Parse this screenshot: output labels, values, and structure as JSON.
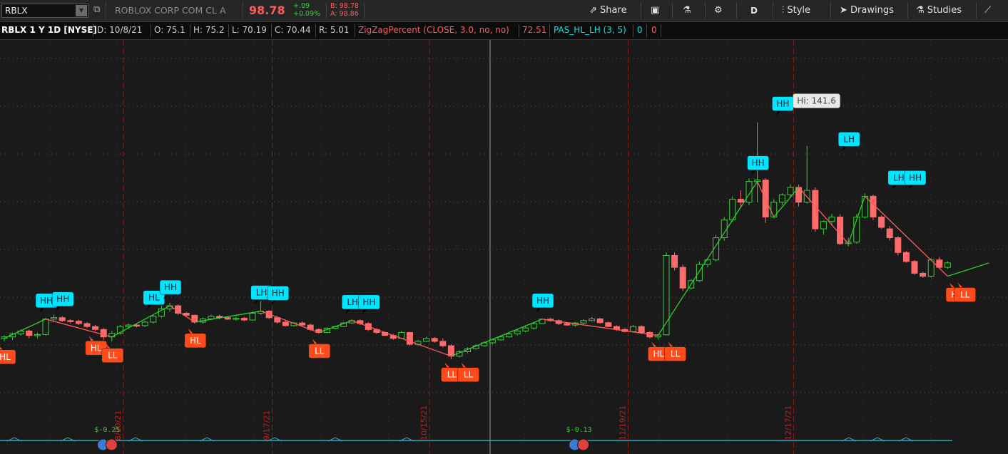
{
  "toolbar": {
    "symbol": "RBLX",
    "company": "ROBLOX CORP COM CL A",
    "price": "98.78",
    "change": "+.09",
    "change_pct": "+0.09%",
    "bid": "B: 98.78",
    "ask": "A: 98.86",
    "share_label": "Share",
    "period_label": "D",
    "style_label": "Style",
    "drawings_label": "Drawings",
    "studies_label": "Studies",
    "colors": {
      "price": "#ff5b5b",
      "up": "#3ccf3c",
      "bid_ask": "#ff5b5b"
    }
  },
  "info": {
    "title": "RBLX 1 Y 1D [NYSE]",
    "date": "D: 10/8/21",
    "open": "O: 75.1",
    "high": "H: 75.2",
    "low": "L: 70.19",
    "close": "C: 70.44",
    "range": "R: 5.01",
    "study1": "ZigZagPercent (CLOSE, 3.0, no, no)",
    "study1_value": "72.51",
    "study2": "PAS_HL_LH (3, 5)",
    "study2_v1": "0",
    "study2_v2": "0"
  },
  "chart_data": {
    "type": "candlestick",
    "ylim": [
      35,
      165
    ],
    "up_color": "#3ccf3c",
    "down_color": "#ff6b6b",
    "candles": [
      [
        69,
        70,
        68,
        69.5
      ],
      [
        69.5,
        71,
        68.5,
        70.5
      ],
      [
        70.5,
        72,
        70,
        71.5
      ],
      [
        71.5,
        72,
        69,
        70
      ],
      [
        70,
        71,
        69,
        70.3
      ],
      [
        70.3,
        76,
        70,
        75.5
      ],
      [
        75.5,
        77,
        74.5,
        76
      ],
      [
        76,
        76.5,
        74.5,
        75
      ],
      [
        75,
        75.5,
        74,
        74.8
      ],
      [
        74.8,
        75.3,
        73.5,
        74
      ],
      [
        74,
        74.5,
        72.5,
        73
      ],
      [
        73,
        73.5,
        71.5,
        72
      ],
      [
        72,
        72.5,
        68.5,
        69.5
      ],
      [
        69.5,
        71.5,
        68,
        70.7
      ],
      [
        70.7,
        73.5,
        70.3,
        73
      ],
      [
        73,
        74,
        72.2,
        73.5
      ],
      [
        73.5,
        74,
        72.7,
        73.3
      ],
      [
        73.3,
        75,
        72.8,
        74.5
      ],
      [
        74.5,
        77,
        74,
        76.5
      ],
      [
        76.5,
        80,
        76,
        79
      ],
      [
        79,
        81,
        78,
        80
      ],
      [
        80,
        80.5,
        77,
        77.5
      ],
      [
        77.5,
        78,
        76.5,
        76.8
      ],
      [
        76.8,
        77,
        74,
        74.5
      ],
      [
        74.5,
        76,
        74,
        75.6
      ],
      [
        75.6,
        77,
        75.2,
        76.5
      ],
      [
        76.5,
        77,
        75.5,
        76
      ],
      [
        76,
        76.5,
        75.2,
        75.5
      ],
      [
        75.5,
        76.3,
        75,
        75.8
      ],
      [
        75.8,
        76.2,
        74.8,
        75.2
      ],
      [
        75.2,
        78,
        75,
        77.5
      ],
      [
        77.5,
        81.5,
        77,
        78.2
      ],
      [
        78.2,
        78.5,
        75.5,
        76
      ],
      [
        76,
        76.5,
        74,
        74.5
      ],
      [
        74.5,
        75,
        73,
        73.3
      ],
      [
        73.3,
        74.5,
        73,
        74.2
      ],
      [
        74.2,
        74.8,
        73.2,
        73.5
      ],
      [
        73.5,
        74,
        71.5,
        72
      ],
      [
        72,
        72.4,
        70.5,
        71
      ],
      [
        71,
        72.8,
        70.8,
        72.4
      ],
      [
        72.4,
        73.3,
        72,
        73
      ],
      [
        73,
        74.5,
        72.8,
        74.2
      ],
      [
        74.2,
        75.5,
        74,
        75
      ],
      [
        75,
        75.4,
        73.5,
        74
      ],
      [
        74,
        74.5,
        71.5,
        72
      ],
      [
        72,
        72.4,
        70.5,
        71
      ],
      [
        71,
        71.3,
        69.8,
        70
      ],
      [
        70,
        70.5,
        68.5,
        69
      ],
      [
        69,
        71.5,
        68.8,
        71
      ],
      [
        71,
        71.2,
        66.5,
        67
      ],
      [
        67,
        68.5,
        66.5,
        68
      ],
      [
        68,
        69.5,
        67.8,
        69
      ],
      [
        69,
        69.4,
        67.5,
        68
      ],
      [
        68,
        69,
        66,
        66.5
      ],
      [
        66.5,
        67,
        62,
        63
      ],
      [
        63,
        65,
        62.5,
        64.5
      ],
      [
        64.5,
        66,
        64,
        65.5
      ],
      [
        65.5,
        67,
        65.2,
        66.5
      ],
      [
        66.5,
        68,
        66.2,
        67.5
      ],
      [
        67.5,
        69,
        67,
        68.5
      ],
      [
        68.5,
        70,
        68.3,
        69.5
      ],
      [
        69.5,
        71,
        69.2,
        70.5
      ],
      [
        70.5,
        72,
        70,
        71.5
      ],
      [
        71.5,
        73,
        71,
        72.5
      ],
      [
        72.5,
        74.5,
        72,
        74
      ],
      [
        74,
        75.7,
        73.8,
        75.5
      ],
      [
        75.5,
        76,
        74.6,
        75
      ],
      [
        75,
        75.4,
        73.5,
        74
      ],
      [
        74,
        74.3,
        73.2,
        73.5
      ],
      [
        73.5,
        74.5,
        73,
        74.2
      ],
      [
        74.2,
        75.5,
        73.8,
        75
      ],
      [
        75,
        76.2,
        74.8,
        75.6
      ],
      [
        75.6,
        76,
        74,
        74.3
      ],
      [
        74.3,
        74.6,
        72.8,
        73
      ],
      [
        73,
        73.4,
        71.5,
        72
      ],
      [
        72,
        72.5,
        71,
        71.3
      ],
      [
        71.3,
        73.5,
        71,
        73
      ],
      [
        73,
        73.4,
        70.5,
        71
      ],
      [
        71,
        71.4,
        69,
        69.5
      ],
      [
        69.5,
        70.4,
        68.5,
        70.2
      ],
      [
        70.2,
        98,
        70,
        97
      ],
      [
        97,
        98,
        92,
        93
      ],
      [
        93,
        94,
        85,
        86
      ],
      [
        86,
        89,
        85.5,
        88.5
      ],
      [
        88.5,
        95,
        88,
        94
      ],
      [
        94,
        96,
        93,
        95.5
      ],
      [
        95.5,
        104,
        95,
        103
      ],
      [
        103,
        110,
        102,
        109
      ],
      [
        109,
        117,
        108.5,
        116
      ],
      [
        116,
        119,
        113,
        115
      ],
      [
        115,
        123,
        114,
        122
      ],
      [
        122,
        142,
        115,
        122.5
      ],
      [
        122.5,
        123,
        108,
        110
      ],
      [
        110,
        116,
        109.5,
        115
      ],
      [
        115,
        118,
        114,
        117.5
      ],
      [
        117.5,
        121,
        116.5,
        120
      ],
      [
        120,
        121,
        113.5,
        115
      ],
      [
        115,
        134,
        114.5,
        119
      ],
      [
        119,
        120,
        105,
        106
      ],
      [
        106,
        109,
        104,
        108.5
      ],
      [
        108.5,
        111,
        107.5,
        110
      ],
      [
        110,
        111,
        100.5,
        101
      ],
      [
        101,
        103,
        100,
        101.5
      ],
      [
        101.5,
        111,
        101,
        110
      ],
      [
        110,
        118,
        109.5,
        117
      ],
      [
        117,
        117.5,
        109,
        110
      ],
      [
        110,
        110.5,
        106,
        106.5
      ],
      [
        106,
        107,
        102,
        103
      ],
      [
        103,
        103.5,
        97,
        98
      ],
      [
        98,
        98.5,
        94.5,
        95
      ],
      [
        95,
        95.5,
        90.5,
        91
      ],
      [
        91,
        91.5,
        89.5,
        90
      ],
      [
        90,
        96,
        89.5,
        95.5
      ],
      [
        95.5,
        96.5,
        92.5,
        93
      ],
      [
        93,
        95,
        92.5,
        94.5
      ]
    ],
    "zigzag": [
      [
        0,
        69
      ],
      [
        5,
        75.5
      ],
      [
        13,
        69.5
      ],
      [
        20,
        80
      ],
      [
        23,
        74.5
      ],
      [
        31,
        78.2
      ],
      [
        38,
        71
      ],
      [
        42,
        75
      ],
      [
        54,
        63
      ],
      [
        65,
        75.5
      ],
      [
        79,
        70
      ],
      [
        91,
        122
      ],
      [
        93,
        110
      ],
      [
        96,
        120
      ],
      [
        102,
        101
      ],
      [
        104,
        117
      ],
      [
        114,
        90
      ],
      [
        119,
        94.5
      ]
    ],
    "labels": [
      {
        "text": "HL",
        "idx": 0,
        "price": 69,
        "pos": "below"
      },
      {
        "text": "HH",
        "idx": 5,
        "price": 75.5,
        "pos": "above"
      },
      {
        "text": "HH",
        "idx": 7,
        "price": 76,
        "pos": "above"
      },
      {
        "text": "HL",
        "idx": 11,
        "price": 72,
        "pos": "below"
      },
      {
        "text": "LL",
        "idx": 13,
        "price": 69.5,
        "pos": "below"
      },
      {
        "text": "HL",
        "idx": 18,
        "price": 76.5,
        "pos": "above"
      },
      {
        "text": "HH",
        "idx": 20,
        "price": 80,
        "pos": "above"
      },
      {
        "text": "HL",
        "idx": 23,
        "price": 74.5,
        "pos": "below"
      },
      {
        "text": "LH",
        "idx": 31,
        "price": 78.2,
        "pos": "above"
      },
      {
        "text": "HH",
        "idx": 33,
        "price": 78,
        "pos": "above"
      },
      {
        "text": "LL",
        "idx": 38,
        "price": 71,
        "pos": "below"
      },
      {
        "text": "LH",
        "idx": 42,
        "price": 75,
        "pos": "above"
      },
      {
        "text": "HH",
        "idx": 44,
        "price": 75,
        "pos": "above"
      },
      {
        "text": "LL",
        "idx": 54,
        "price": 63,
        "pos": "below"
      },
      {
        "text": "LL",
        "idx": 56,
        "price": 63,
        "pos": "below"
      },
      {
        "text": "HH",
        "idx": 65,
        "price": 75.5,
        "pos": "above"
      },
      {
        "text": "HL",
        "idx": 79,
        "price": 70,
        "pos": "below"
      },
      {
        "text": "LL",
        "idx": 81,
        "price": 70,
        "pos": "below"
      },
      {
        "text": "HH",
        "idx": 91,
        "price": 122,
        "pos": "above"
      },
      {
        "text": "HH",
        "idx": 94,
        "price": 142,
        "pos": "above"
      },
      {
        "text": "LH",
        "idx": 102,
        "price": 130,
        "pos": "above"
      },
      {
        "text": "HL",
        "idx": 115,
        "price": 90,
        "pos": "below"
      },
      {
        "text": "LL",
        "idx": 116,
        "price": 90,
        "pos": "below"
      },
      {
        "text": "LH",
        "idx": 108,
        "price": 117,
        "pos": "above"
      },
      {
        "text": "HH",
        "idx": 110,
        "price": 117,
        "pos": "above"
      }
    ],
    "hi_label": {
      "text": "Hi: 141.6",
      "idx": 96,
      "price": 142
    },
    "date_ticks": [
      {
        "label": "8/20/21",
        "idx": 13
      },
      {
        "label": "9/17/21",
        "idx": 31
      },
      {
        "label": "10/15/21",
        "idx": 50
      },
      {
        "label": "11/19/21",
        "idx": 74
      },
      {
        "label": "12/17/21",
        "idx": 94
      }
    ],
    "dividends": [
      {
        "label": "$-0.25",
        "idx": 9
      },
      {
        "label": "$-0.13",
        "idx": 66
      }
    ]
  }
}
